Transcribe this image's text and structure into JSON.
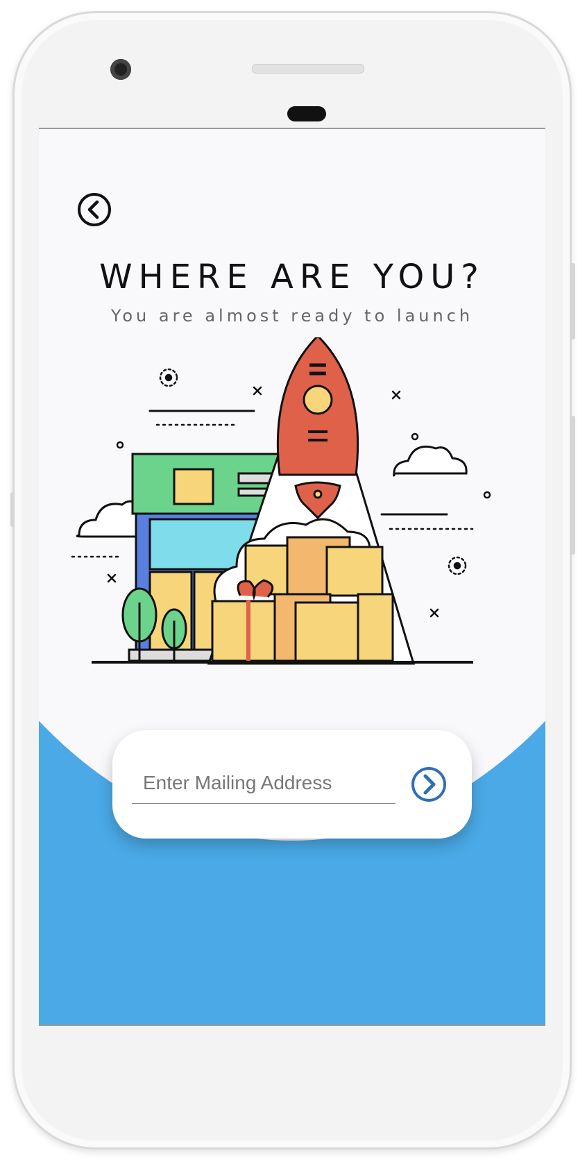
{
  "header": {
    "title": "WHERE ARE YOU?",
    "subtitle": "You are almost ready to launch"
  },
  "address_form": {
    "placeholder": "Enter Mailing Address",
    "value": ""
  },
  "icons": {
    "back": "chevron-left-circle-icon",
    "submit": "chevron-right-circle-icon",
    "illustration": "rocket-launch-packages-illustration"
  },
  "colors": {
    "screen_background": "#4aa9e6",
    "card_background": "#ffffff",
    "accent_blue": "#2f6fb5",
    "rocket_red": "#e0614a",
    "box_yellow": "#f7d57a",
    "store_green": "#6bd38c"
  }
}
